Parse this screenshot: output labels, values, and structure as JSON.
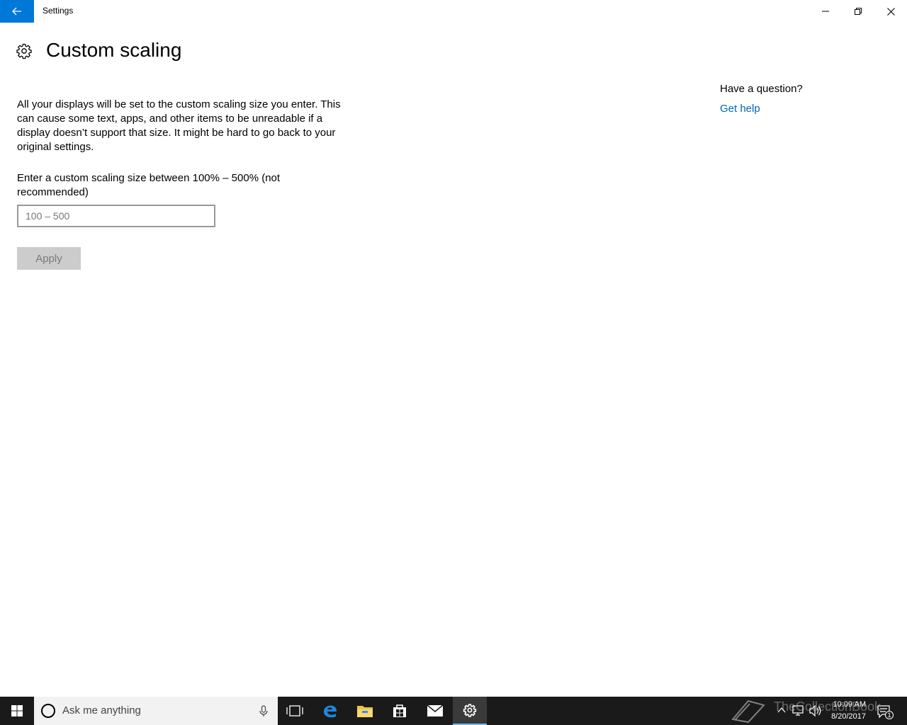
{
  "window": {
    "app_title": "Settings"
  },
  "page": {
    "title": "Custom scaling",
    "description": "All your displays will be set to the custom scaling size you enter. This can cause some text, apps, and other items to be unreadable if a display doesn’t support that size. It might be hard to go back to your original settings.",
    "prompt": "Enter a custom scaling size between 100% – 500% (not recommended)",
    "input": {
      "value": "",
      "placeholder": "100 – 500"
    },
    "apply_label": "Apply"
  },
  "help": {
    "question": "Have a question?",
    "link": "Get help"
  },
  "taskbar": {
    "search_placeholder": "Ask me anything",
    "clock_time": "10:09 AM",
    "clock_date": "8/20/2017",
    "notification_count": "1",
    "watermark": "TheCollectionBook"
  },
  "colors": {
    "accent": "#0078d7",
    "link": "#0066b4",
    "taskbar": "#1a1a1a"
  }
}
